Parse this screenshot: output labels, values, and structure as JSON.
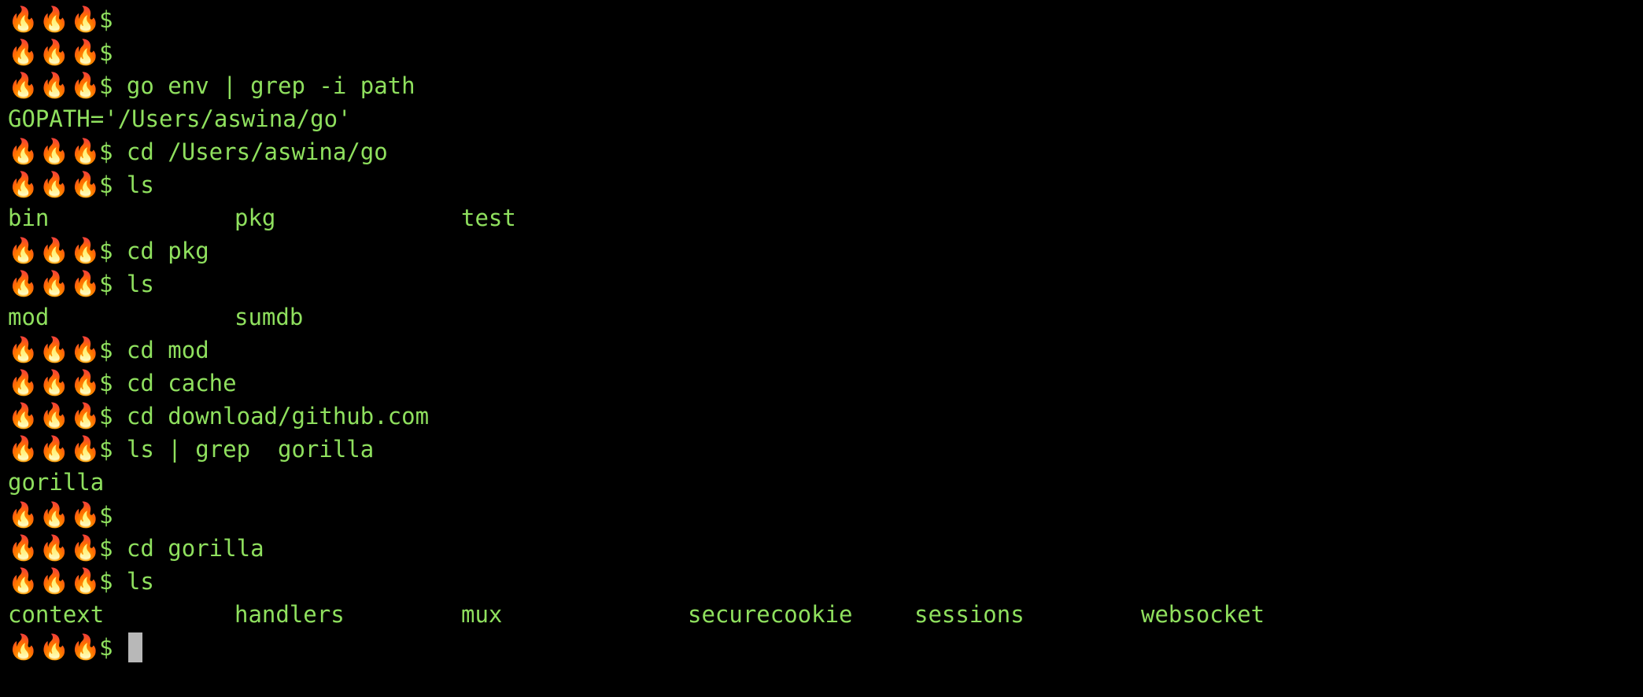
{
  "terminal": {
    "prompt": "🔥🔥🔥",
    "prompt_sign": "$",
    "colors": {
      "background": "#000000",
      "text": "#8fe05e",
      "cursor": "#b8b8b8"
    },
    "lines": [
      {
        "type": "prompt",
        "cmd": ""
      },
      {
        "type": "prompt",
        "cmd": ""
      },
      {
        "type": "prompt",
        "cmd": "go env | grep -i path"
      },
      {
        "type": "output",
        "text": "GOPATH='/Users/aswina/go'"
      },
      {
        "type": "prompt",
        "cmd": "cd /Users/aswina/go"
      },
      {
        "type": "prompt",
        "cmd": "ls"
      },
      {
        "type": "columns",
        "items": [
          "bin",
          "pkg",
          "test"
        ]
      },
      {
        "type": "prompt",
        "cmd": "cd pkg"
      },
      {
        "type": "prompt",
        "cmd": "ls"
      },
      {
        "type": "columns",
        "items": [
          "mod",
          "sumdb"
        ]
      },
      {
        "type": "prompt",
        "cmd": "cd mod"
      },
      {
        "type": "prompt",
        "cmd": "cd cache"
      },
      {
        "type": "prompt",
        "cmd": "cd download/github.com"
      },
      {
        "type": "prompt",
        "cmd": "ls | grep  gorilla"
      },
      {
        "type": "output",
        "text": "gorilla"
      },
      {
        "type": "prompt",
        "cmd": ""
      },
      {
        "type": "prompt",
        "cmd": "cd gorilla"
      },
      {
        "type": "prompt",
        "cmd": "ls"
      },
      {
        "type": "columns",
        "items": [
          "context",
          "handlers",
          "mux",
          "securecookie",
          "sessions",
          "websocket"
        ]
      },
      {
        "type": "prompt",
        "cmd": "",
        "cursor": true
      }
    ]
  }
}
